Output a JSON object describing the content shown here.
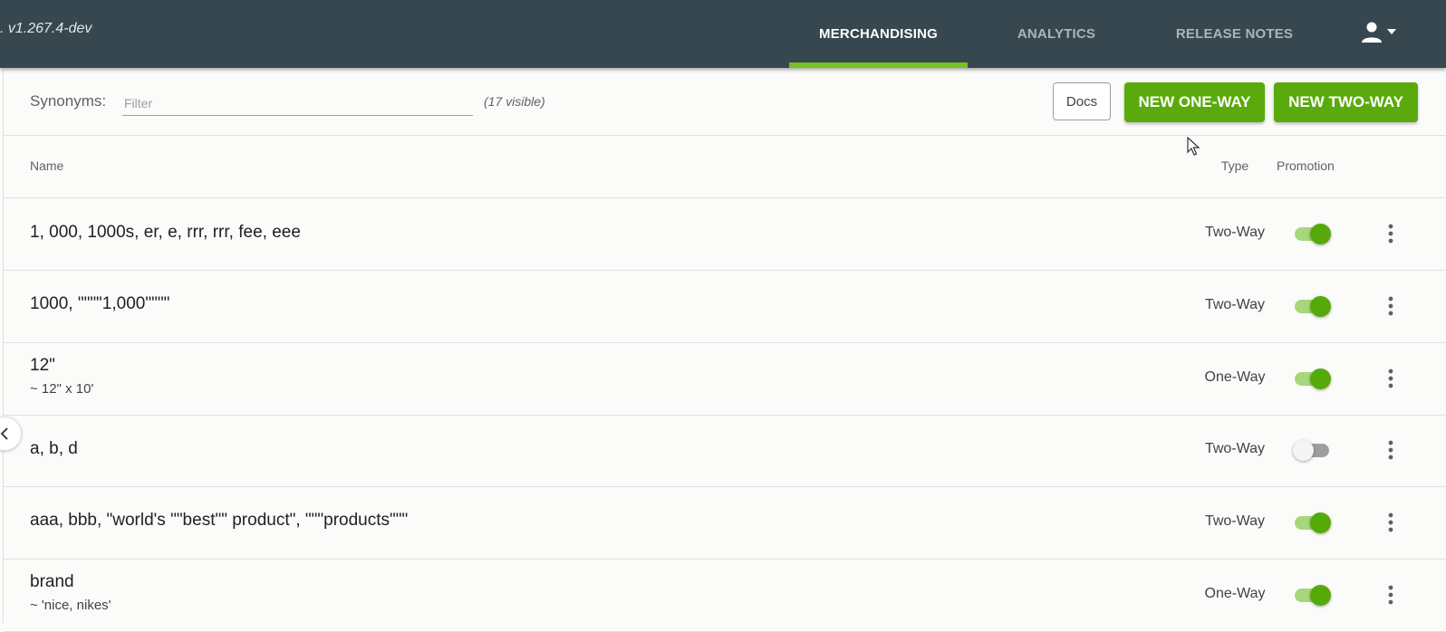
{
  "header": {
    "version": ". v1.267.4-dev",
    "tabs": [
      {
        "label": "MERCHANDISING",
        "active": true
      },
      {
        "label": "ANALYTICS",
        "active": false
      },
      {
        "label": "RELEASE NOTES",
        "active": false
      }
    ],
    "user_icon": "person-icon",
    "menu_icon": "caret-down-icon"
  },
  "toolbar": {
    "label": "Synonyms:",
    "filter_placeholder": "Filter",
    "filter_value": "",
    "visible_count": "(17 visible)",
    "docs_label": "Docs",
    "new_one_way_label": "NEW ONE-WAY",
    "new_two_way_label": "NEW TWO-WAY"
  },
  "table": {
    "columns": {
      "name": "Name",
      "type": "Type",
      "promotion": "Promotion"
    },
    "rows": [
      {
        "title": "1, 000, 1000s, er, e, rrr, rrr, fee, eee",
        "subtitle": "",
        "type": "Two-Way",
        "promotion": true
      },
      {
        "title": "1000, \"\"\"\"1,000\"\"\"\"",
        "subtitle": "",
        "type": "Two-Way",
        "promotion": true
      },
      {
        "title": "12\"",
        "subtitle": "~ 12\" x 10'",
        "type": "One-Way",
        "promotion": true
      },
      {
        "title": "a, b, d",
        "subtitle": "",
        "type": "Two-Way",
        "promotion": false
      },
      {
        "title": "aaa, bbb, \"world's \"\"best\"\" product\", \"\"\"products\"\"\"",
        "subtitle": "",
        "type": "Two-Way",
        "promotion": true
      },
      {
        "title": "brand",
        "subtitle": "~ 'nice, nikes'",
        "type": "One-Way",
        "promotion": true
      }
    ]
  },
  "colors": {
    "topbar": "#37474f",
    "accent_green": "#5aaa0d",
    "active_tab_underline": "#76c11f"
  }
}
